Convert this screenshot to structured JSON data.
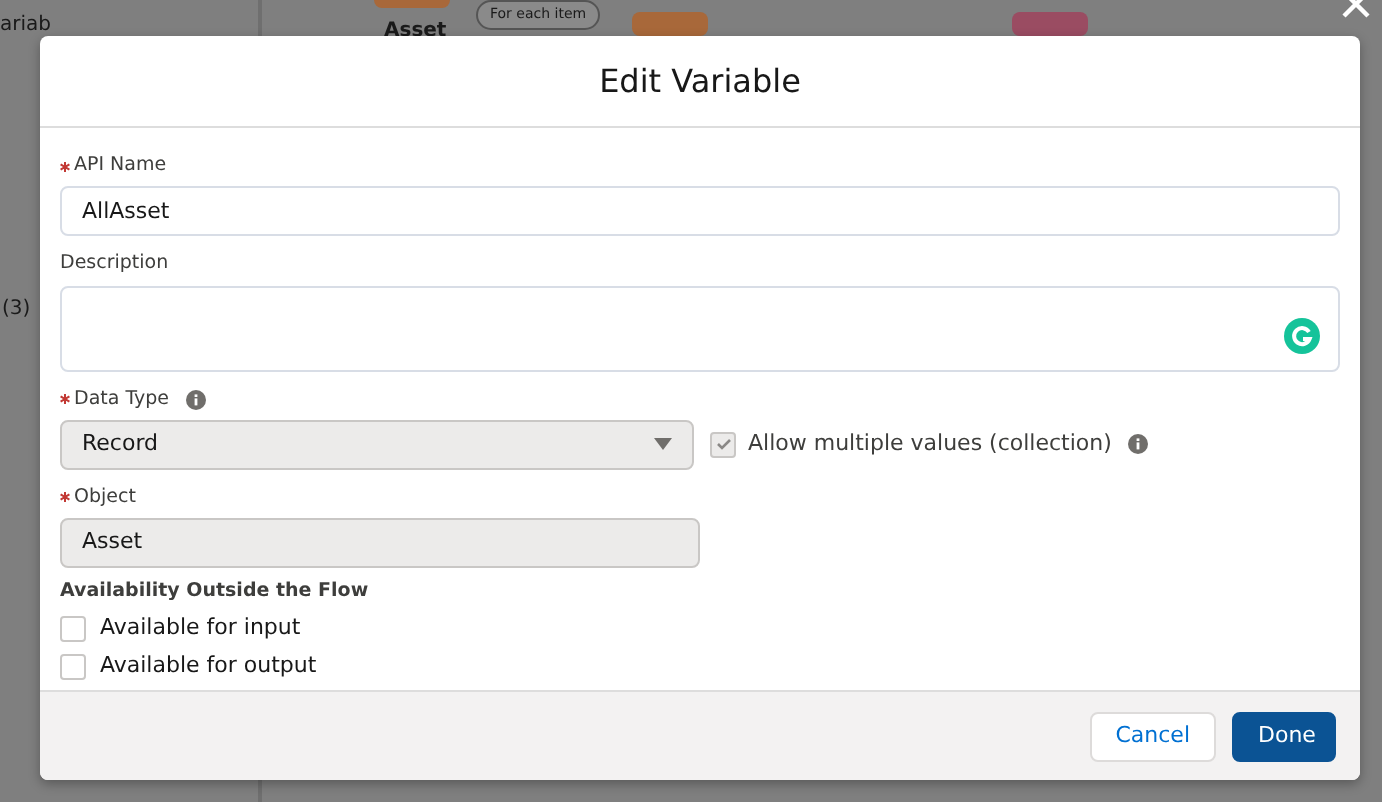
{
  "background": {
    "sidebar_texts": [
      "ariab",
      "(3)"
    ],
    "canvas": {
      "node_label": "Asset",
      "loop_tag": "For each item"
    }
  },
  "modal": {
    "title": "Edit Variable",
    "api_name": {
      "label": "API Name",
      "required": true,
      "value": "AllAsset"
    },
    "description": {
      "label": "Description"
    },
    "data_type": {
      "label": "Data Type",
      "required": true,
      "value": "Record",
      "disabled": true
    },
    "allow_multiple": {
      "label": "Allow multiple values (collection)",
      "checked": true,
      "disabled": true
    },
    "object": {
      "label": "Object",
      "required": true,
      "value": "Asset",
      "disabled": true
    },
    "availability": {
      "heading": "Availability Outside the Flow",
      "options": [
        {
          "label": "Available for input",
          "checked": false
        },
        {
          "label": "Available for output",
          "checked": false
        }
      ]
    },
    "buttons": [
      {
        "label": "Cancel",
        "kind": "neutral"
      },
      {
        "label": "Done",
        "kind": "brand"
      }
    ]
  }
}
